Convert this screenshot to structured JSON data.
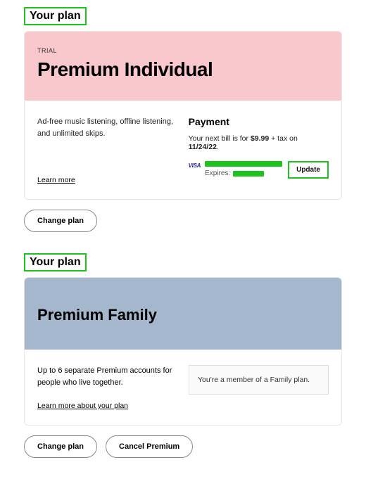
{
  "section1": {
    "title": "Your plan",
    "trial": "TRIAL",
    "plan_name": "Premium Individual",
    "description": "Ad-free music listening, offline listening, and unlimited skips.",
    "learn": "Learn more",
    "payment_title": "Payment",
    "bill_prefix": "Your next bill is for ",
    "bill_amount": "$9.99",
    "bill_mid": " + tax on ",
    "bill_date": "11/24/22",
    "bill_suffix": ".",
    "card_brand": "VISA",
    "expires_label": "Expires:",
    "update": "Update",
    "change_plan": "Change plan"
  },
  "section2": {
    "title": "Your plan",
    "plan_name": "Premium Family",
    "description": "Up to 6 separate Premium accounts for people who live together.",
    "learn": "Learn more about your plan",
    "member_notice": "You're a member of a Family plan.",
    "change_plan": "Change plan",
    "cancel": "Cancel Premium"
  }
}
